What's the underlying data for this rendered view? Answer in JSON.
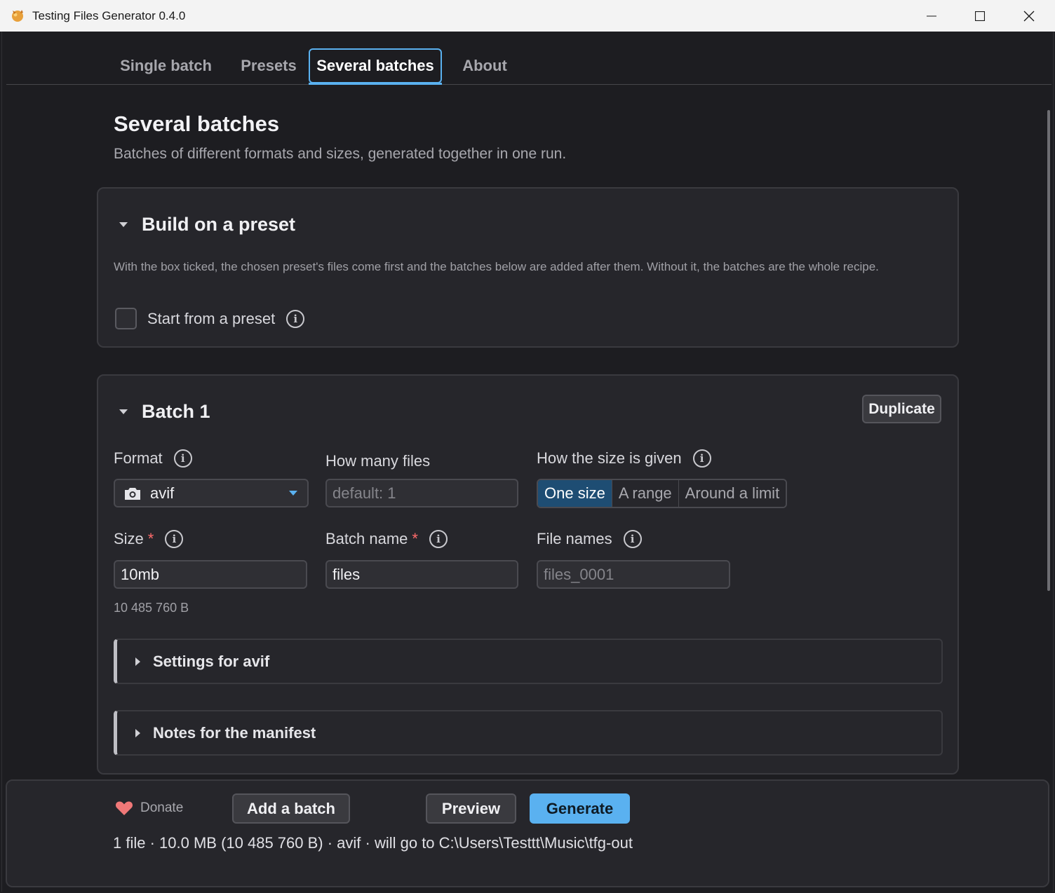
{
  "window": {
    "title": "Testing Files Generator 0.4.0"
  },
  "tabs": [
    {
      "label": "Single batch"
    },
    {
      "label": "Presets"
    },
    {
      "label": "Several batches",
      "active": true
    },
    {
      "label": "About"
    }
  ],
  "page": {
    "title": "Several batches",
    "subtitle": "Batches of different formats and sizes, generated together in one run."
  },
  "preset_section": {
    "heading": "Build on a preset",
    "description": "With the box ticked, the chosen preset's files come first and the batches below are added after them. Without it, the batches are the whole recipe.",
    "checkbox_label": "Start from a preset",
    "checked": false
  },
  "batch": {
    "heading": "Batch 1",
    "duplicate_label": "Duplicate",
    "format": {
      "label": "Format",
      "value": "avif",
      "icon": "camera-icon"
    },
    "count": {
      "label": "How many files",
      "placeholder": "default: 1"
    },
    "size_mode": {
      "label": "How the size is given",
      "options": [
        "One size",
        "A range",
        "Around a limit"
      ],
      "selected": "One size"
    },
    "size": {
      "label": "Size",
      "required_mark": "*",
      "value": "10mb",
      "bytes_hint": "10 485 760 B"
    },
    "batch_name": {
      "label": "Batch name",
      "required_mark": "*",
      "value": "files"
    },
    "file_names": {
      "label": "File names",
      "placeholder": "files_0001"
    },
    "settings_label": "Settings for avif",
    "notes_label": "Notes for the manifest"
  },
  "footer": {
    "donate_label": "Donate",
    "add_batch_label": "Add a batch",
    "preview_label": "Preview",
    "generate_label": "Generate",
    "status": "1 file · 10.0 MB (10 485 760 B) · avif · will go to C:\\Users\\Testtt\\Music\\tfg-out"
  },
  "colors": {
    "accent": "#5ab1f0",
    "background": "#1d1d21",
    "card": "#26262b",
    "required": "#ff6b6b",
    "heart": "#f07878"
  }
}
